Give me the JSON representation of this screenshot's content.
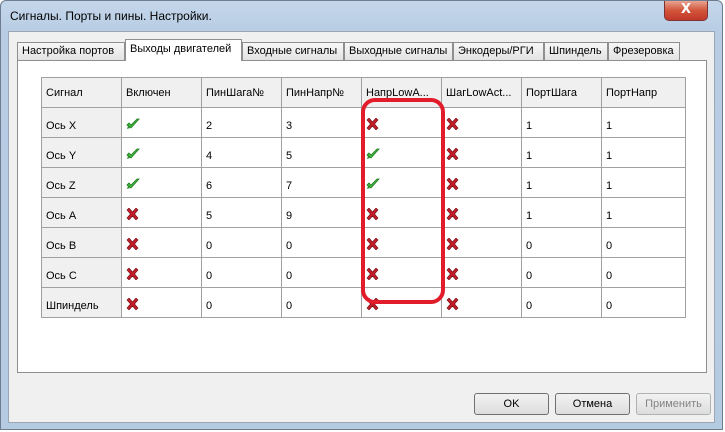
{
  "window": {
    "title": "Сигналы. Порты и пины. Настройки.",
    "close_glyph": "X"
  },
  "tabs": [
    {
      "label": "Настройка портов",
      "active": false
    },
    {
      "label": "Выходы двигателей",
      "active": true
    },
    {
      "label": "Входные сигналы",
      "active": false
    },
    {
      "label": "Выходные сигналы",
      "active": false
    },
    {
      "label": "Энкодеры/РГИ",
      "active": false
    },
    {
      "label": "Шпиндель",
      "active": false
    },
    {
      "label": "Фрезеровка",
      "active": false
    }
  ],
  "table": {
    "columns": [
      "Сигнал",
      "Включен",
      "ПинШага№",
      "ПинНапр№",
      "НапрLowA...",
      "ШагLowAct...",
      "ПортШага",
      "ПортНапр"
    ],
    "rows": [
      {
        "signal": "Ось X",
        "enabled": true,
        "step_pin": "2",
        "dir_pin": "3",
        "dir_low_active": false,
        "step_low_active": false,
        "step_port": "1",
        "dir_port": "1"
      },
      {
        "signal": "Ось Y",
        "enabled": true,
        "step_pin": "4",
        "dir_pin": "5",
        "dir_low_active": true,
        "step_low_active": false,
        "step_port": "1",
        "dir_port": "1"
      },
      {
        "signal": "Ось Z",
        "enabled": true,
        "step_pin": "6",
        "dir_pin": "7",
        "dir_low_active": true,
        "step_low_active": false,
        "step_port": "1",
        "dir_port": "1"
      },
      {
        "signal": "Ось A",
        "enabled": false,
        "step_pin": "5",
        "dir_pin": "9",
        "dir_low_active": false,
        "step_low_active": false,
        "step_port": "1",
        "dir_port": "1"
      },
      {
        "signal": "Ось B",
        "enabled": false,
        "step_pin": "0",
        "dir_pin": "0",
        "dir_low_active": false,
        "step_low_active": false,
        "step_port": "0",
        "dir_port": "0"
      },
      {
        "signal": "Ось C",
        "enabled": false,
        "step_pin": "0",
        "dir_pin": "0",
        "dir_low_active": false,
        "step_low_active": false,
        "step_port": "0",
        "dir_port": "0"
      },
      {
        "signal": "Шпиндель",
        "enabled": false,
        "step_pin": "0",
        "dir_pin": "0",
        "dir_low_active": false,
        "step_low_active": false,
        "step_port": "0",
        "dir_port": "0"
      }
    ]
  },
  "highlight_color": "#e21c2a",
  "icons": {
    "yes": "green-check-icon",
    "no": "red-x-icon"
  },
  "buttons": {
    "ok": "OK",
    "cancel": "Отмена",
    "apply": "Применить"
  }
}
